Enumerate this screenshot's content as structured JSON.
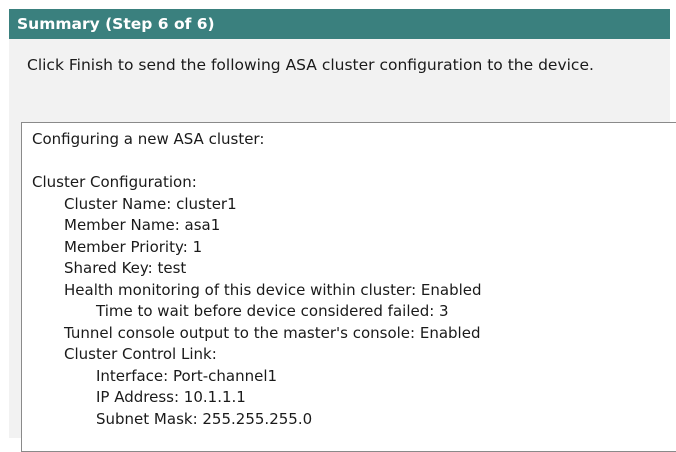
{
  "title": "Summary (Step 6 of 6)",
  "instruction": "Click Finish to send the following ASA cluster configuration to the device.",
  "summary": {
    "header": "Configuring a new ASA cluster:",
    "section_title": "Cluster Configuration:",
    "cluster_name": "Cluster Name: cluster1",
    "member_name": "Member Name: asa1",
    "member_priority": "Member Priority: 1",
    "shared_key": "Shared Key: test",
    "health_monitoring": "Health monitoring of this device within cluster: Enabled",
    "wait_time": "Time to wait before device considered failed: 3",
    "tunnel_console": "Tunnel console output to the master's console: Enabled",
    "ccl_title": "Cluster Control Link:",
    "ccl_interface": "Interface: Port-channel1",
    "ccl_ip": "IP Address: 10.1.1.1",
    "ccl_mask": "Subnet Mask: 255.255.255.0"
  },
  "colors": {
    "title_bar": "#3a807e",
    "panel_background": "#f2f2f2",
    "summary_background": "#ffffff"
  }
}
